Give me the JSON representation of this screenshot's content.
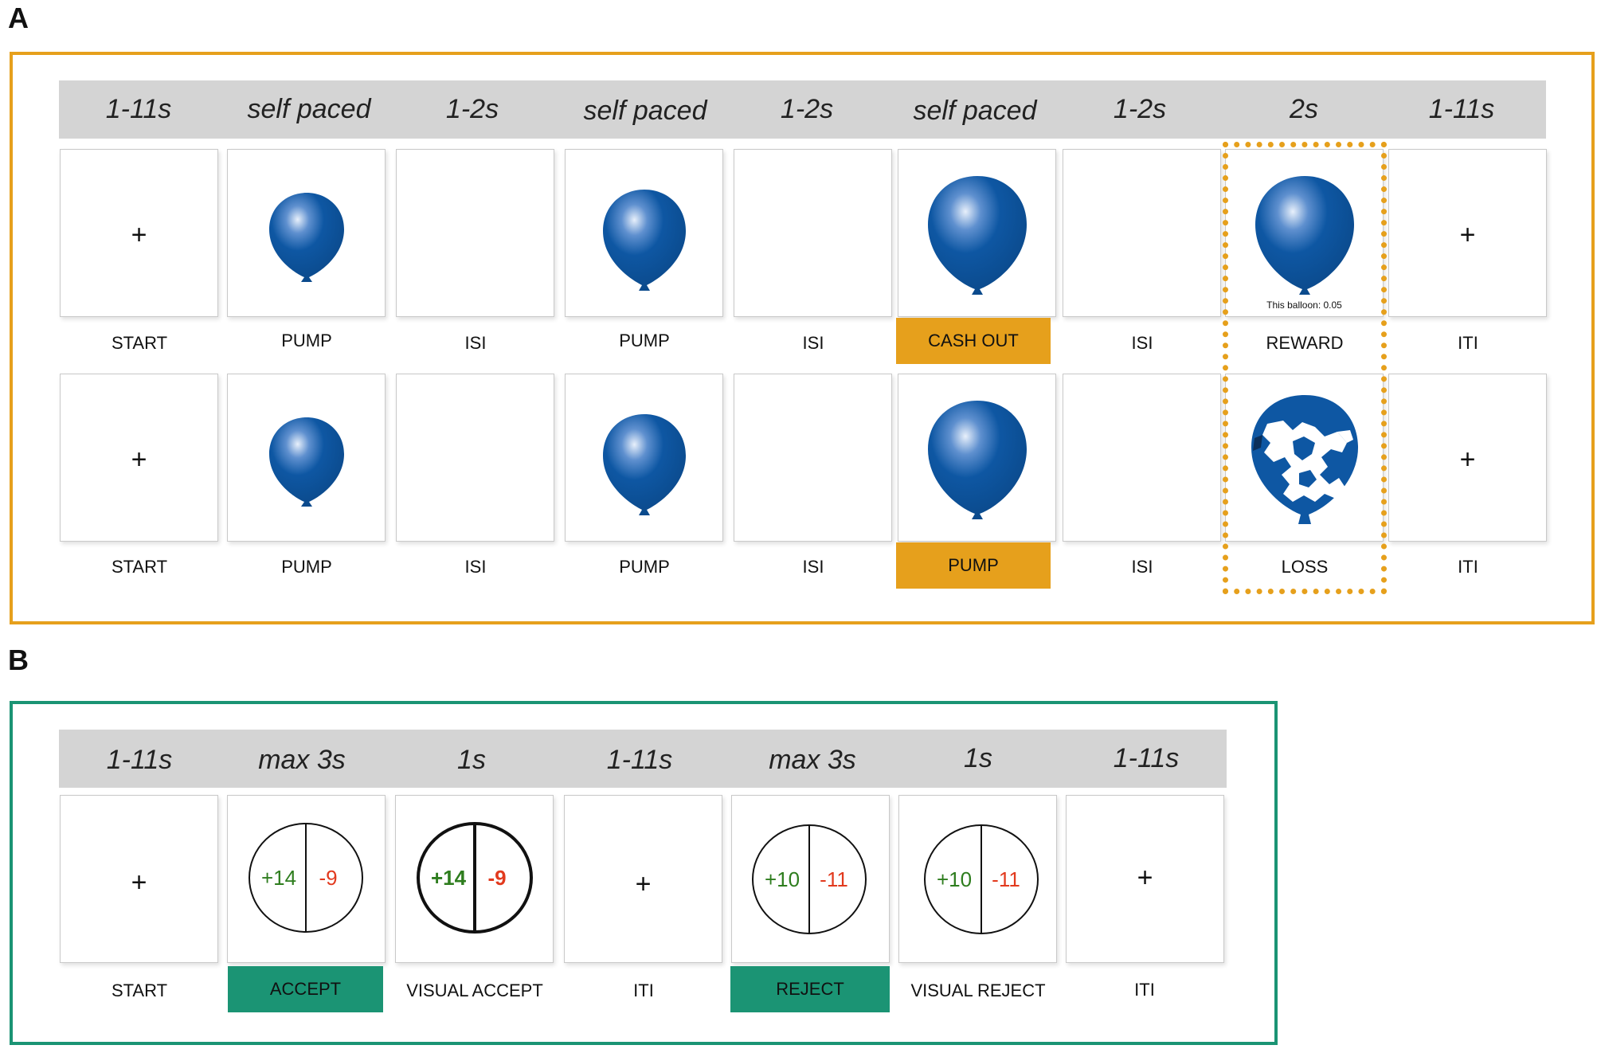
{
  "colors": {
    "panel_a": "#e6a01c",
    "panel_b": "#1b9474",
    "balloon": "#0e57a3",
    "gain": "#2e7d1e",
    "loss": "#e23a1e"
  },
  "panel_a": {
    "letter": "A",
    "timings": [
      "1-11s",
      "self paced",
      "1-2s",
      "self paced",
      "1-2s",
      "self paced",
      "1-2s",
      "2s",
      "1-11s"
    ],
    "row1_captions": [
      "START",
      "PUMP",
      "ISI",
      "PUMP",
      "ISI",
      "CASH OUT",
      "ISI",
      "REWARD",
      "ITI"
    ],
    "row2_captions": [
      "START",
      "PUMP",
      "ISI",
      "PUMP",
      "ISI",
      "PUMP",
      "ISI",
      "LOSS",
      "ITI"
    ],
    "fixation": "+",
    "reward_note": "This balloon: 0.05"
  },
  "panel_b": {
    "letter": "B",
    "timings": [
      "1-11s",
      "max 3s",
      "1s",
      "1-11s",
      "max 3s",
      "1s",
      "1-11s"
    ],
    "captions": [
      "START",
      "ACCEPT",
      "VISUAL ACCEPT",
      "ITI",
      "REJECT",
      "VISUAL REJECT",
      "ITI"
    ],
    "fixation": "+",
    "gamble1": {
      "gain": "+14",
      "loss": "-9"
    },
    "gamble2": {
      "gain": "+10",
      "loss": "-11"
    }
  }
}
